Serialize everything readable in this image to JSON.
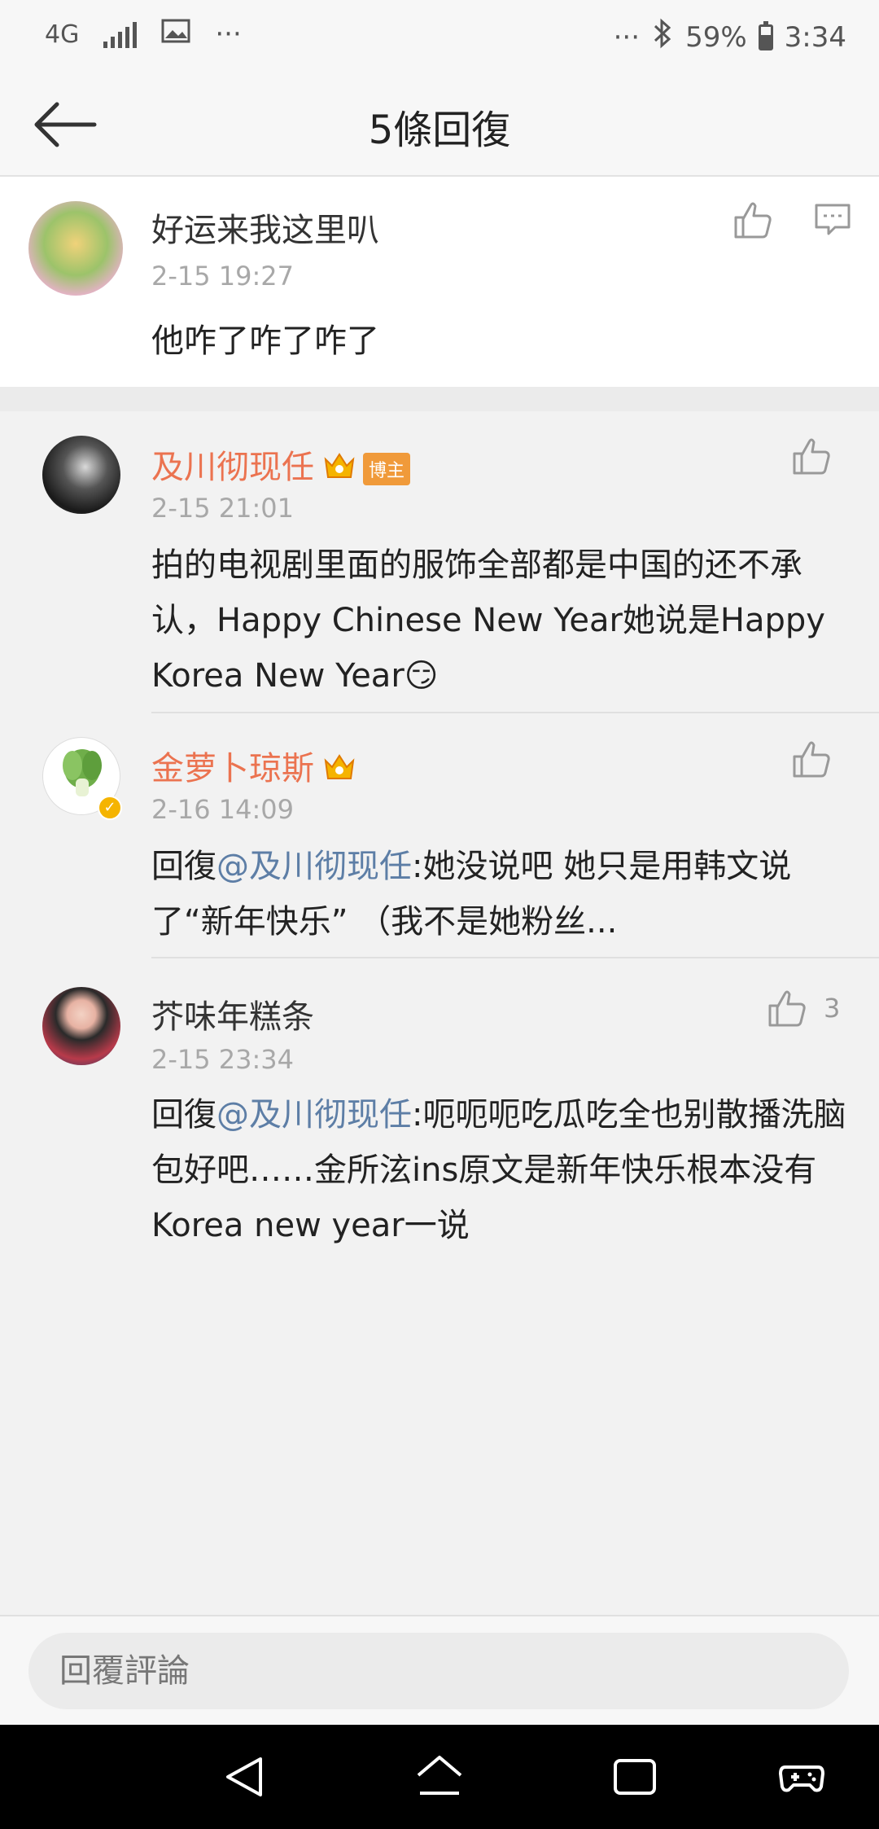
{
  "status_bar": {
    "network": "4G",
    "more": "···",
    "more_right": "···",
    "battery": "59%",
    "time": "3:34"
  },
  "header": {
    "title": "5條回復"
  },
  "main_comment": {
    "username": "好运来我这里叭",
    "time": "2-15 19:27",
    "text": "他咋了咋了咋了"
  },
  "replies": [
    {
      "username": "及川彻现任",
      "badge": "博主",
      "time": "2-15 21:01",
      "text": "拍的电视剧里面的服饰全部都是中国的还不承认，Happy Chinese New Year她说是Happy Korea New Year",
      "emoji": "😏",
      "likes": ""
    },
    {
      "username": "金萝卜琼斯",
      "time": "2-16 14:09",
      "prefix": "回復",
      "mention": "@及川彻现任",
      "text": ":她没说吧 她只是用韩文说了“新年快乐” （我不是她粉丝...",
      "likes": ""
    },
    {
      "username": "芥味年糕条",
      "time": "2-15 23:34",
      "prefix": "回復",
      "mention": "@及川彻现任",
      "text": ":呃呃呃吃瓜吃全也别散播洗脑包好吧……金所泫ins原文是新年快乐根本没有Korea new year一说",
      "likes": "3"
    }
  ],
  "reply_bar": {
    "placeholder": "回覆評論"
  },
  "colors": {
    "accent_orange": "#eb7350",
    "mention_blue": "#5d7ea6",
    "badge_orange": "#f09a3a"
  }
}
